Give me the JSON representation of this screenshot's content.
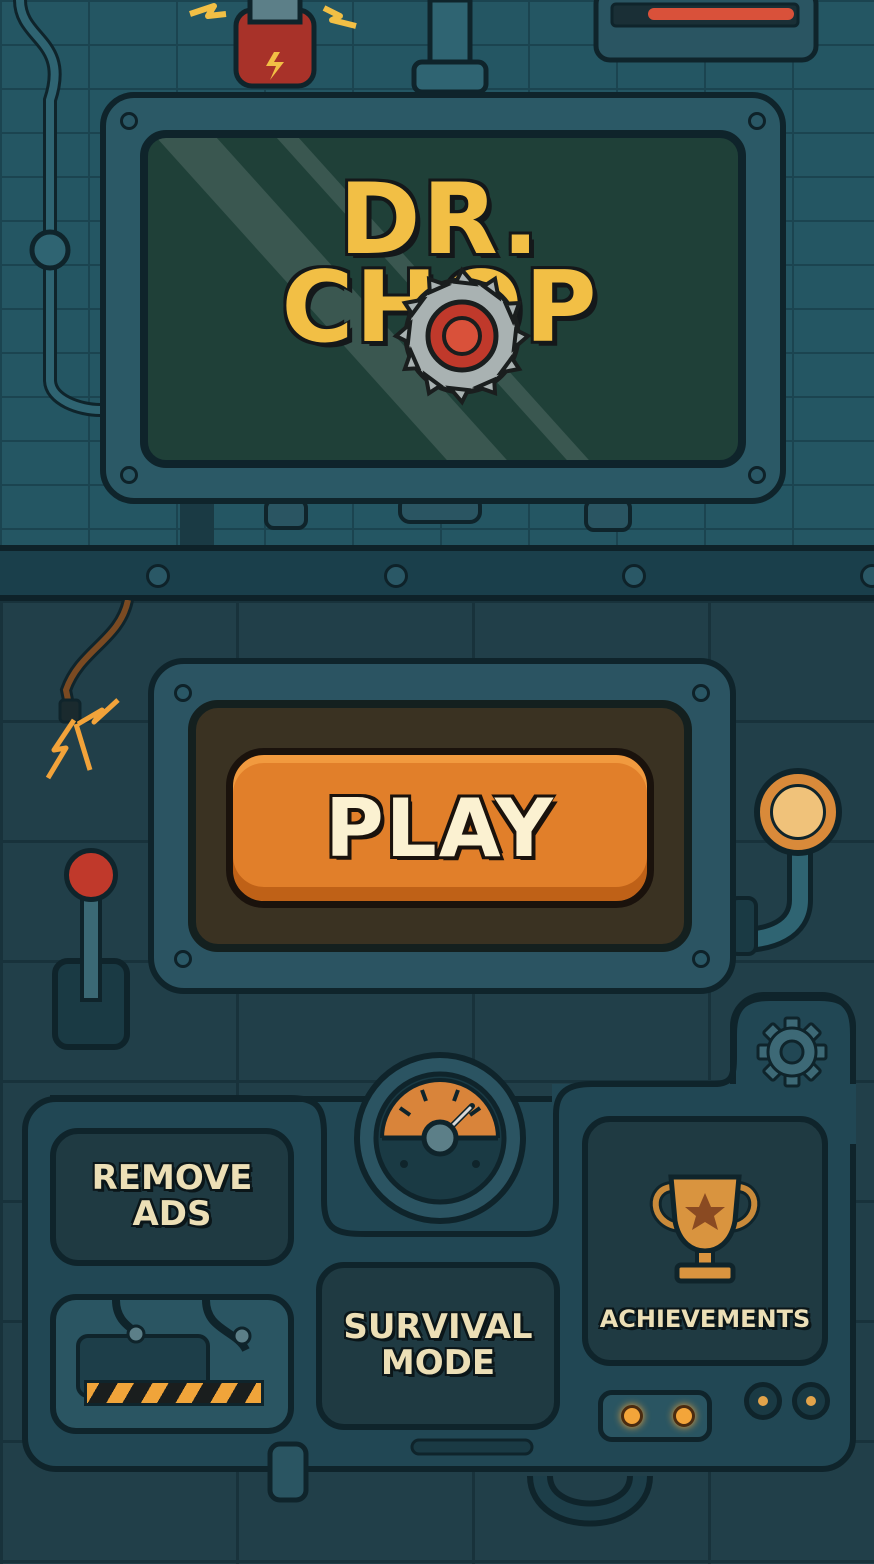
{
  "title": {
    "logo_line1": "DR.",
    "logo_line2": "CHOP"
  },
  "menu": {
    "play_label": "PLAY",
    "remove_ads_label": "REMOVE\nADS",
    "survival_label": "SURVIVAL\nMODE",
    "achievements_label": "ACHIEVEMENTS"
  },
  "icons": {
    "settings": "gear-icon",
    "achievements": "trophy-icon",
    "logo_saw": "saw-blade-icon"
  },
  "colors": {
    "accent_orange": "#e17f2a",
    "logo_yellow": "#f2bf45",
    "panel_teal": "#214754",
    "lamp_amber": "#f3a53a"
  }
}
